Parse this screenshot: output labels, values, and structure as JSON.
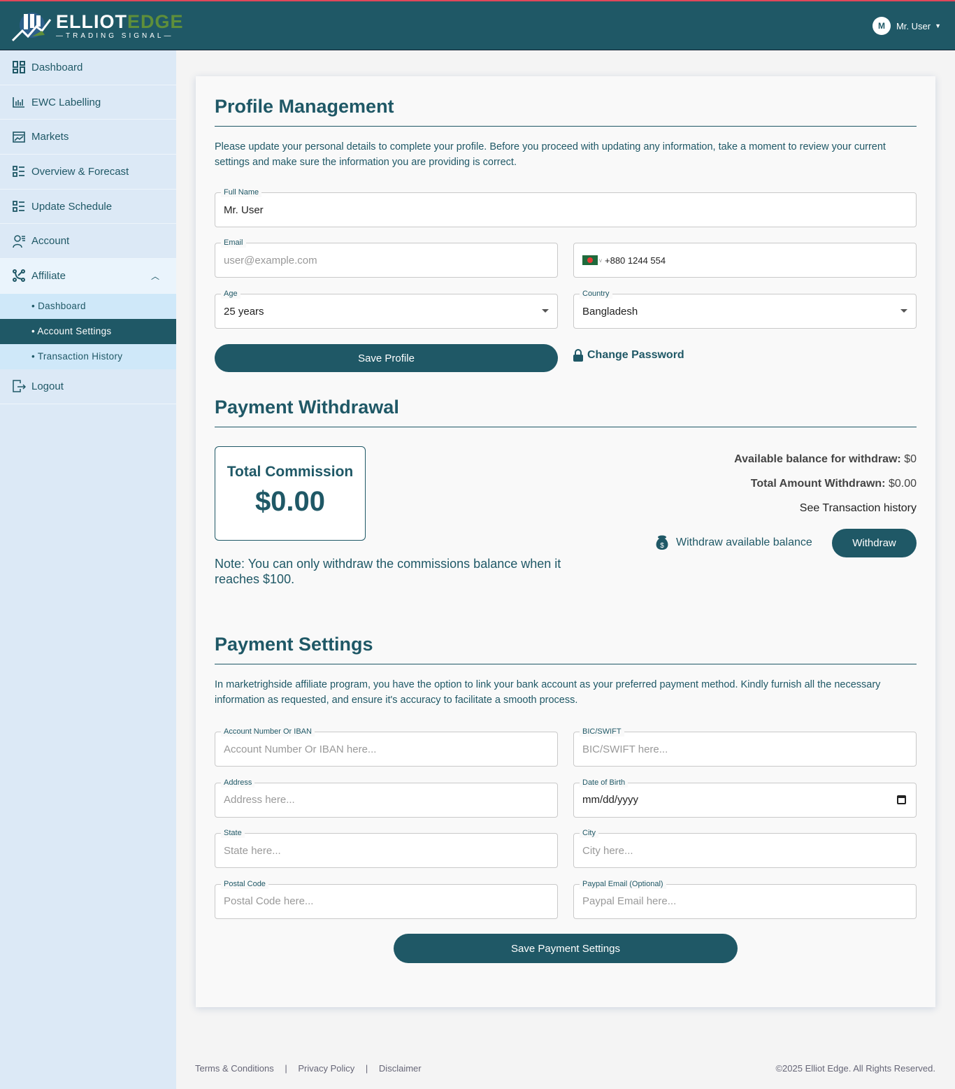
{
  "header": {
    "logo_main": "ELLIOT",
    "logo_accent": "EDGE",
    "logo_sub": "—TRADING SIGNAL—",
    "user_initial": "M",
    "user_name": "Mr. User"
  },
  "sidebar": {
    "items": [
      {
        "label": "Dashboard",
        "icon": "dashboard-icon"
      },
      {
        "label": "EWC Labelling",
        "icon": "chart-icon"
      },
      {
        "label": "Markets",
        "icon": "markets-icon"
      },
      {
        "label": "Overview & Forecast",
        "icon": "list-icon"
      },
      {
        "label": "Update Schedule",
        "icon": "list-icon"
      },
      {
        "label": "Account",
        "icon": "user-icon"
      },
      {
        "label": "Affiliate",
        "icon": "affiliate-icon"
      }
    ],
    "affiliate_sub": [
      "• Dashboard",
      "• Account Settings",
      "• Transaction History"
    ],
    "logout": "Logout"
  },
  "profile": {
    "title": "Profile Management",
    "desc": "Please update your personal details to complete your profile. Before you proceed with updating any information, take a moment to review your current settings and make sure the information you are providing is correct.",
    "full_name_label": "Full Name",
    "full_name": "Mr. User",
    "email_label": "Email",
    "email_placeholder": "user@example.com",
    "phone": "+880 1244 554",
    "age_label": "Age",
    "age": "25 years",
    "country_label": "Country",
    "country": "Bangladesh",
    "save": "Save Profile",
    "change_password": "Change Password"
  },
  "withdrawal": {
    "title": "Payment Withdrawal",
    "commission_label": "Total Commission",
    "commission": "$0.00",
    "available_label": "Available balance for withdraw:",
    "available": "$0",
    "withdrawn_label": "Total Amount Withdrawn:",
    "withdrawn": "$0.00",
    "history_link": "See Transaction history",
    "withdraw_label": "Withdraw available balance",
    "withdraw_button": "Withdraw",
    "note": "Note: You can only withdraw the commissions balance when it reaches $100."
  },
  "payment": {
    "title": "Payment Settings",
    "desc": "In marketrighside affiliate program, you have the option to link your bank account as your preferred payment method. Kindly furnish all the necessary information as requested, and ensure it's accuracy to facilitate a smooth process.",
    "fields": [
      {
        "label": "Account Number Or IBAN",
        "placeholder": "Account Number Or IBAN here..."
      },
      {
        "label": "BIC/SWIFT",
        "placeholder": "BIC/SWIFT here..."
      },
      {
        "label": "Address",
        "placeholder": "Address here..."
      },
      {
        "label": "Date of Birth",
        "value": "mm/dd/yyyy"
      },
      {
        "label": "State",
        "placeholder": "State here..."
      },
      {
        "label": "City",
        "placeholder": "City here..."
      },
      {
        "label": "Postal Code",
        "placeholder": "Postal Code here..."
      },
      {
        "label": "Paypal Email (Optional)",
        "placeholder": "Paypal Email here..."
      }
    ],
    "save": "Save Payment Settings"
  },
  "footer": {
    "links": [
      "Terms & Conditions",
      "Privacy Policy",
      "Disclaimer"
    ],
    "sep": "|",
    "copyright": "©2025 Elliot Edge. All Rights Reserved."
  }
}
